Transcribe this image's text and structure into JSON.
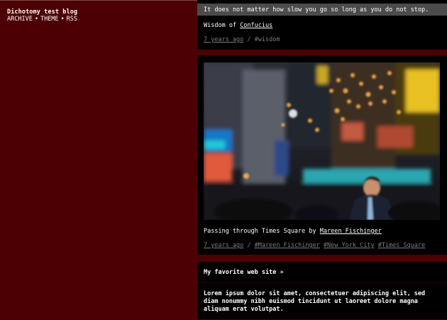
{
  "sidebar": {
    "blog_title": "Dichotomy test blog",
    "nav": [
      {
        "label": "ARCHIVE"
      },
      {
        "label": "THEME"
      },
      {
        "label": "RSS"
      }
    ],
    "separator": "•"
  },
  "posts": {
    "quote": {
      "text": "It does not matter how slow you go so long as you do not stop.",
      "source_prefix": "Wisdom of",
      "source_author": "Confucius",
      "time": "7 years ago",
      "tags": [
        "#wisdom"
      ]
    },
    "photo": {
      "caption_prefix": "Passing through Times Square by",
      "caption_author": "Mareen Fischinger",
      "time": "7 years ago",
      "tags": [
        "#Mareen Fischinger",
        "#New York City",
        "#Times Square"
      ]
    },
    "link": {
      "title": "My favorite web site »",
      "body": "Lorem ipsum dolor sit amet, consectetuer adipiscing elit, sed diam nonummy nibh euismod tincidunt ut laoreet dolore magna aliquam erat volutpat."
    }
  },
  "colors": {
    "background": "#4d0003",
    "post_background": "#000000",
    "quote_bar": "#4b4b4b",
    "meta_text": "#7d7d7d"
  }
}
